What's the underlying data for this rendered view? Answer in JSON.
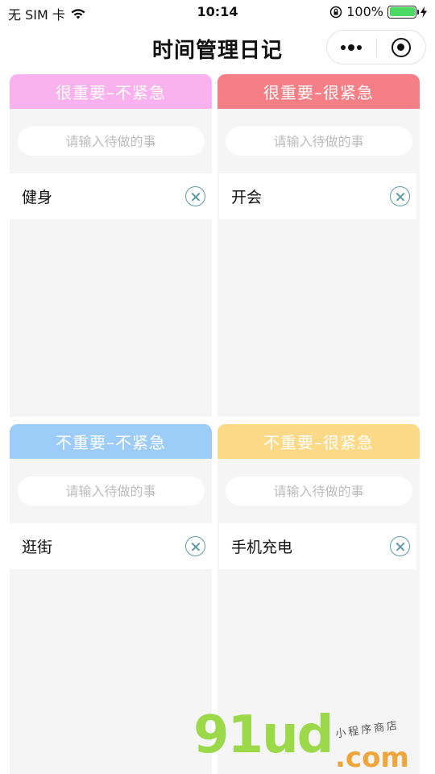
{
  "status_bar": {
    "carrier": "无 SIM 卡",
    "time": "10:14",
    "battery_percent": "100%",
    "battery_level": 1.0
  },
  "nav": {
    "title": "时间管理日记"
  },
  "quadrants": [
    {
      "title": "很重要–不紧急",
      "color": "#f9b2ee",
      "placeholder": "请输入待做的事",
      "tasks": [
        "健身"
      ]
    },
    {
      "title": "很重要–很紧急",
      "color": "#f57f86",
      "placeholder": "请输入待做的事",
      "tasks": [
        "开会"
      ]
    },
    {
      "title": "不重要–不紧急",
      "color": "#9cccf7",
      "placeholder": "请输入待做的事",
      "tasks": [
        "逛街"
      ]
    },
    {
      "title": "不重要–很紧急",
      "color": "#fbd987",
      "placeholder": "请输入待做的事",
      "tasks": [
        "手机充电"
      ]
    }
  ],
  "watermark": {
    "logo": "91ud",
    "domain": ".com",
    "subtitle": "小程序商店"
  },
  "icons": {
    "wifi": "wifi-icon",
    "orientation_lock": "orientation-lock-icon",
    "charging": "charging-bolt-icon",
    "more": "more-dots-icon",
    "close_app": "target-close-icon",
    "delete": "delete-circle-x-icon"
  }
}
